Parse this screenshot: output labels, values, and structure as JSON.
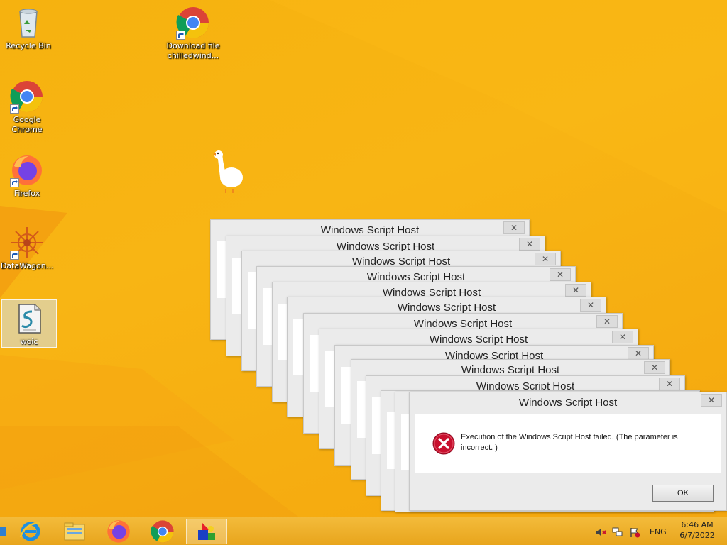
{
  "desktop_icons": [
    {
      "label": "Recycle Bin",
      "icon": "recycle-bin-icon"
    },
    {
      "label": "Download file chilledwind...",
      "icon": "chrome-icon"
    },
    {
      "label": "Google Chrome",
      "icon": "chrome-icon"
    },
    {
      "label": "Firefox",
      "icon": "firefox-icon"
    },
    {
      "label": "DataWagon...",
      "icon": "datawagon-icon"
    },
    {
      "label": "woic",
      "icon": "script-file-icon"
    }
  ],
  "dialog": {
    "title": "Windows Script Host",
    "message": "Execution of the Windows Script Host failed. (The parameter is incorrect. )",
    "ok_label": "OK",
    "close_glyph": "✕",
    "icon": "error-icon"
  },
  "taskbar": {
    "apps": [
      {
        "name": "internet-explorer-icon"
      },
      {
        "name": "file-explorer-icon"
      },
      {
        "name": "firefox-icon"
      },
      {
        "name": "chrome-icon"
      },
      {
        "name": "script-host-icon",
        "active": true
      }
    ],
    "tray": {
      "language": "ENG",
      "time": "6:46 AM",
      "date": "6/7/2022"
    }
  },
  "colors": {
    "wallpaper": "#f8b514",
    "taskbar": "#eaa91e",
    "error_red": "#c8102e"
  }
}
